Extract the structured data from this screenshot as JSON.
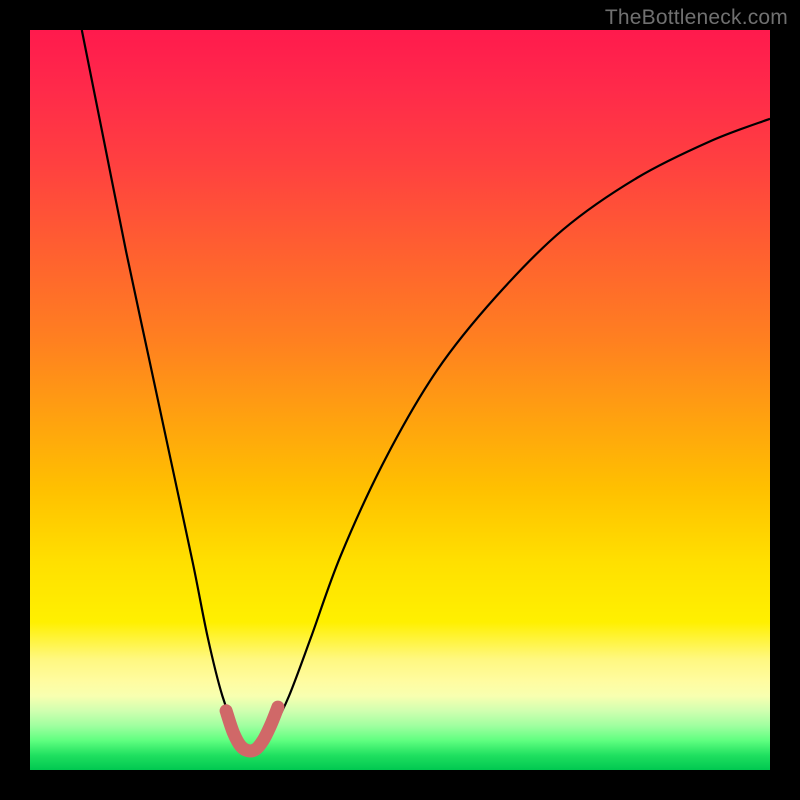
{
  "watermark": "TheBottleneck.com",
  "chart_data": {
    "type": "line",
    "title": "",
    "xlabel": "",
    "ylabel": "",
    "xlim": [
      0,
      100
    ],
    "ylim": [
      0,
      100
    ],
    "series": [
      {
        "name": "bottleneck-curve-black",
        "color": "#000000",
        "x": [
          7,
          10,
          13,
          16,
          19,
          22,
          24,
          26,
          28,
          29.5,
          31,
          33,
          35,
          38,
          42,
          48,
          55,
          63,
          72,
          82,
          92,
          100
        ],
        "y": [
          100,
          85,
          70,
          56,
          42,
          28,
          18,
          10,
          5,
          3,
          3.5,
          6,
          10,
          18,
          29,
          42,
          54,
          64,
          73,
          80,
          85,
          88
        ]
      },
      {
        "name": "bottleneck-curve-highlight",
        "color": "#d86a6a",
        "x": [
          26.5,
          27.5,
          28.5,
          29.5,
          30.5,
          31.5,
          32.5,
          33.5
        ],
        "y": [
          8,
          5,
          3.2,
          2.6,
          2.8,
          4,
          6,
          8.5
        ]
      }
    ],
    "gradient_stops": [
      {
        "pos": 0,
        "color": "#ff1a4d"
      },
      {
        "pos": 50,
        "color": "#ffc000"
      },
      {
        "pos": 85,
        "color": "#fff880"
      },
      {
        "pos": 100,
        "color": "#00c850"
      }
    ]
  }
}
